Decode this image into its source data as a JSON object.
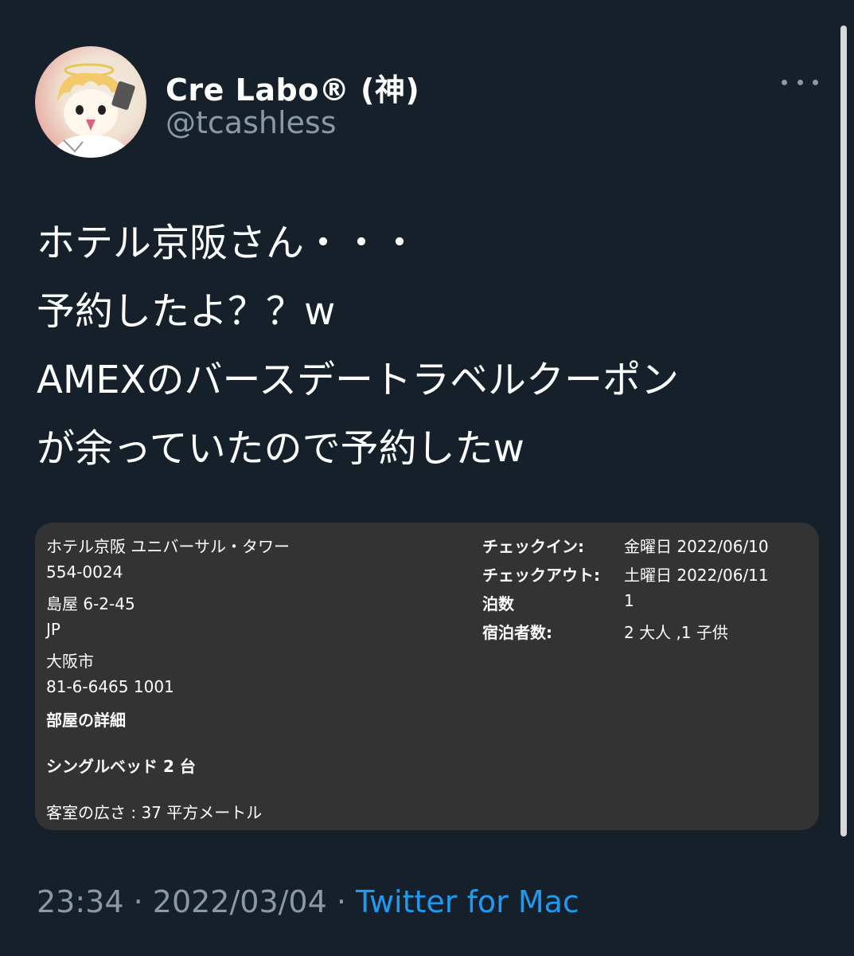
{
  "user": {
    "display_name": "Cre Labo® (神)",
    "handle": "@tcashless"
  },
  "tweet": {
    "lines": [
      "ホテル京阪さん・・・",
      "予約したよ？？w",
      "AMEXのバースデートラベルクーポン",
      "が余っていたので予約したw"
    ]
  },
  "card": {
    "hotel_name": "ホテル京阪 ユニバーサル・タワー",
    "postal_code": "554-0024",
    "address": "島屋 6-2-45",
    "country": "JP",
    "city": "大阪市",
    "phone": "81-6-6465 1001",
    "room_details_heading": "部屋の詳細",
    "bed": "シングルベッド 2 台",
    "room_size": "客室の広さ : 37 平方メートル",
    "checkin_label": "チェックイン:",
    "checkin_value": "金曜日 2022/06/10",
    "checkout_label": "チェックアウト:",
    "checkout_value": "土曜日 2022/06/11",
    "nights_label": "泊数",
    "nights_value": "1",
    "guests_label": "宿泊者数:",
    "guests_value": "2 大人 ,1 子供"
  },
  "meta": {
    "time": "23:34",
    "separator": " · ",
    "date": "2022/03/04",
    "source": "Twitter for Mac"
  },
  "colors": {
    "background": "#15202b",
    "link": "#1d9bf0",
    "secondary_text": "#8b98a5",
    "card_background": "#333333"
  }
}
